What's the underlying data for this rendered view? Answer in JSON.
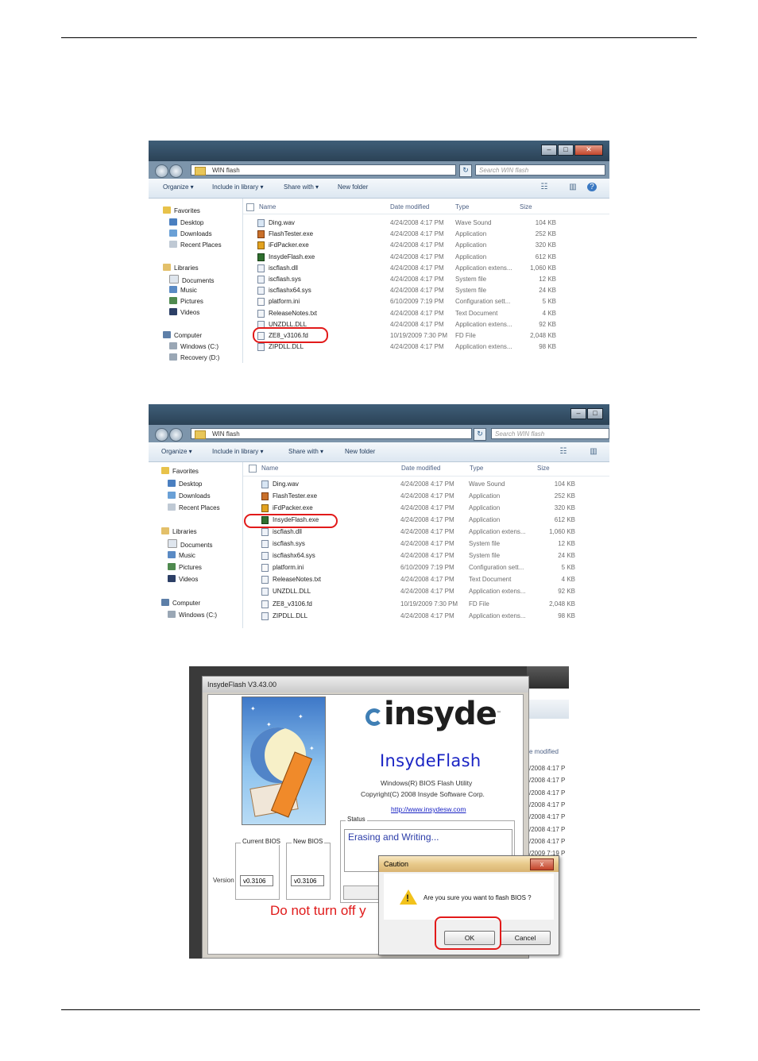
{
  "explorer": {
    "address": "WIN flash",
    "search_placeholder": "Search WIN flash",
    "toolbar": {
      "organize": "Organize ▾",
      "include_in_library": "Include in library ▾",
      "share_with": "Share with ▾",
      "new_folder": "New folder"
    },
    "nav": {
      "favorites": "Favorites",
      "desktop": "Desktop",
      "downloads": "Downloads",
      "recent_places": "Recent Places",
      "libraries": "Libraries",
      "documents": "Documents",
      "music": "Music",
      "pictures": "Pictures",
      "videos": "Videos",
      "computer": "Computer",
      "windows_c": "Windows (C:)",
      "recovery_d": "Recovery (D:)"
    },
    "columns": {
      "name": "Name",
      "date": "Date modified",
      "type": "Type",
      "size": "Size"
    },
    "files": [
      {
        "name": "Ding.wav",
        "date": "4/24/2008 4:17 PM",
        "type": "Wave Sound",
        "size": "104 KB"
      },
      {
        "name": "FlashTester.exe",
        "date": "4/24/2008 4:17 PM",
        "type": "Application",
        "size": "252 KB"
      },
      {
        "name": "iFdPacker.exe",
        "date": "4/24/2008 4:17 PM",
        "type": "Application",
        "size": "320 KB"
      },
      {
        "name": "InsydeFlash.exe",
        "date": "4/24/2008 4:17 PM",
        "type": "Application",
        "size": "612 KB"
      },
      {
        "name": "iscflash.dll",
        "date": "4/24/2008 4:17 PM",
        "type": "Application extens...",
        "size": "1,060 KB"
      },
      {
        "name": "iscflash.sys",
        "date": "4/24/2008 4:17 PM",
        "type": "System file",
        "size": "12 KB"
      },
      {
        "name": "iscflashx64.sys",
        "date": "4/24/2008 4:17 PM",
        "type": "System file",
        "size": "24 KB"
      },
      {
        "name": "platform.ini",
        "date": "6/10/2009 7:19 PM",
        "type": "Configuration sett...",
        "size": "5 KB"
      },
      {
        "name": "ReleaseNotes.txt",
        "date": "4/24/2008 4:17 PM",
        "type": "Text Document",
        "size": "4 KB"
      },
      {
        "name": "UNZDLL.DLL",
        "date": "4/24/2008 4:17 PM",
        "type": "Application extens...",
        "size": "92 KB"
      },
      {
        "name": "ZE8_v3106.fd",
        "date": "10/19/2009 7:30 PM",
        "type": "FD File",
        "size": "2,048 KB"
      },
      {
        "name": "ZIPDLL.DLL",
        "date": "4/24/2008 4:17 PM",
        "type": "Application extens...",
        "size": "98 KB"
      }
    ]
  },
  "insyde": {
    "window_title": "InsydeFlash V3.43.00",
    "logo": "insyde",
    "product_name": "InsydeFlash",
    "subtitle": "Windows(R) BIOS Flash Utility",
    "copyright": "Copyright(C) 2008 Insyde Software Corp.",
    "url": "http://www.insydesw.com",
    "current_bios_label": "Current BIOS",
    "new_bios_label": "New BIOS",
    "version_label": "Version",
    "current_bios_version": "v0.3106",
    "new_bios_version": "v0.3106",
    "status_label": "Status",
    "status_text": "Erasing and Writing...",
    "warning": "Do not turn off y",
    "background_column": "e modified",
    "background_dates": [
      "/2008 4:17 P",
      "/2008 4:17 P",
      "/2008 4:17 P",
      "/2008 4:17 P",
      "/2008 4:17 P",
      "/2008 4:17 P",
      "/2008 4:17 P",
      "/2009 7:19 P"
    ]
  },
  "caution": {
    "title": "Caution",
    "close": "x",
    "message": "Are you sure you want to flash BIOS ?",
    "ok": "OK",
    "cancel": "Cancel"
  }
}
